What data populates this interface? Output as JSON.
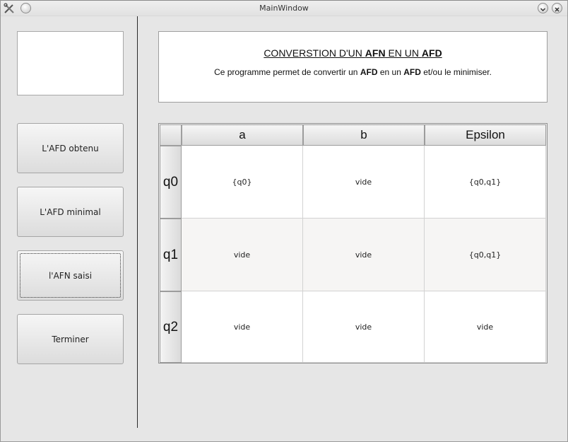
{
  "window": {
    "title": "MainWindow"
  },
  "sidebar": {
    "buttons": [
      {
        "label": "L'AFD obtenu"
      },
      {
        "label": "L'AFD minimal"
      },
      {
        "label": "l'AFN saisi"
      },
      {
        "label": "Terminer"
      }
    ]
  },
  "info": {
    "title_pre": "CONVERSTION D'UN ",
    "title_afn": "AFN",
    "title_mid": " EN UN ",
    "title_afd": "AFD",
    "desc_1": "Ce programme permet de convertir un ",
    "desc_afd": "AFD",
    "desc_2": " en un ",
    "desc_afd2": "AFD",
    "desc_3": " et/ou le minimiser."
  },
  "table": {
    "columns": [
      "a",
      "b",
      "Epsilon"
    ],
    "rows": [
      {
        "state": "q0",
        "cells": [
          "{q0}",
          "vide",
          "{q0,q1}"
        ]
      },
      {
        "state": "q1",
        "cells": [
          "vide",
          "vide",
          "{q0,q1}"
        ]
      },
      {
        "state": "q2",
        "cells": [
          "vide",
          "vide",
          "vide"
        ]
      }
    ]
  },
  "icons": {
    "app": "scissors-tools-icon",
    "pin": "pin-icon",
    "minimize": "chevron-down-icon",
    "close": "close-icon"
  }
}
